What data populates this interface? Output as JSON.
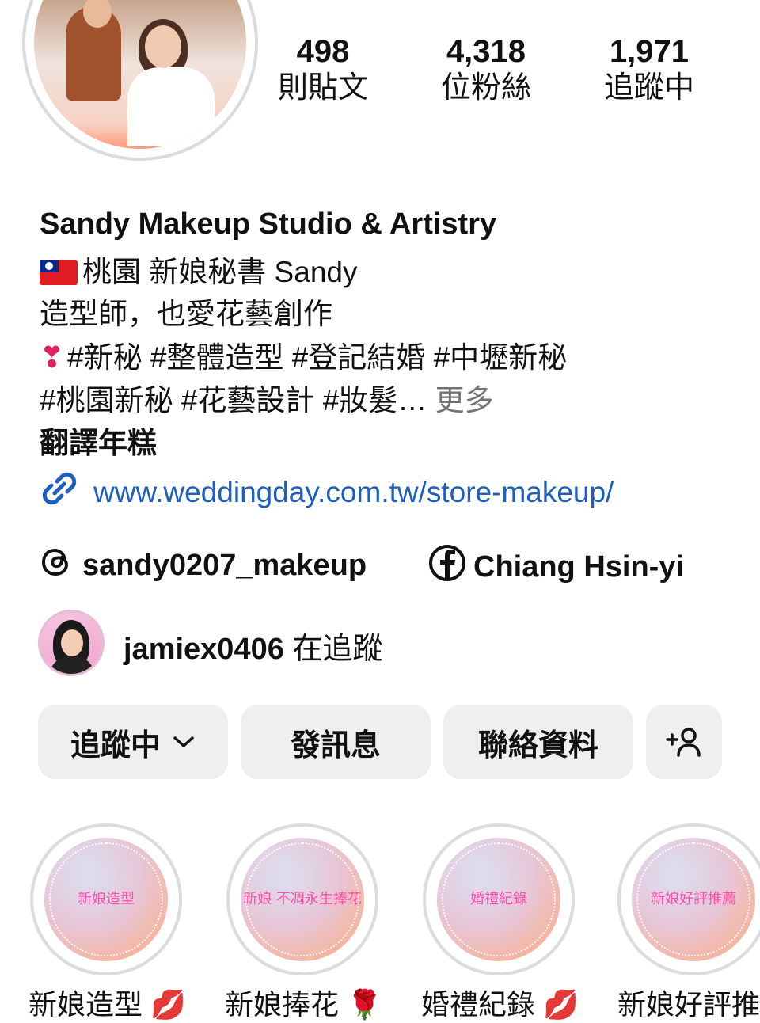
{
  "stats": [
    {
      "value": "498",
      "label": "則貼文"
    },
    {
      "value": "4,318",
      "label": "位粉絲"
    },
    {
      "value": "1,971",
      "label": "追蹤中"
    }
  ],
  "profile": {
    "name": "Sandy Makeup Studio & Artistry",
    "bio": [
      "桃園 新娘秘書 Sandy",
      "造型師，也愛花藝創作",
      "#新秘 #整體造型 #登記結婚 #中壢新秘",
      "#桃園新秘 #花藝設計 #妝髮…"
    ],
    "bio_more": "更多",
    "translate": "翻譯年糕",
    "heart_emoji": "❣",
    "link": "www.weddingday.com.tw/store-makeup/",
    "threads_handle": "sandy0207_makeup",
    "facebook_name": "Chiang Hsin-yi"
  },
  "mutual": {
    "username": "jamiex0406",
    "suffix": "在追蹤"
  },
  "buttons": {
    "following": "追蹤中",
    "message": "發訊息",
    "contact": "聯絡資料"
  },
  "highlights": [
    {
      "inner": "新娘造型",
      "label": "新娘造型",
      "emoji": "💋"
    },
    {
      "inner": "新娘 不凋永生捧花",
      "label": "新娘捧花",
      "emoji": "🌹"
    },
    {
      "inner": "婚禮紀錄",
      "label": "婚禮紀錄",
      "emoji": "💋"
    },
    {
      "inner": "新娘好評推薦",
      "label": "新娘好評推薦",
      "emoji": ""
    }
  ],
  "colors": {
    "link": "#1d5fbf",
    "button_bg": "#efeff1",
    "muted": "#737373"
  }
}
